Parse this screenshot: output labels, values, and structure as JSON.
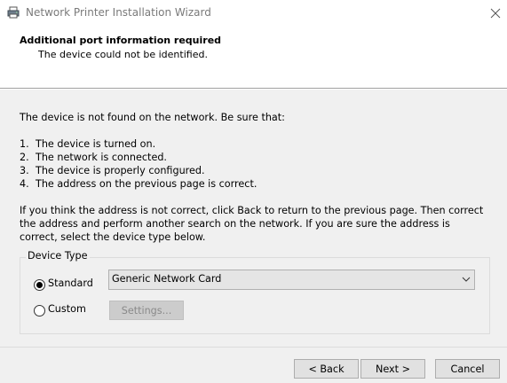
{
  "window": {
    "title": "Network Printer Installation Wizard"
  },
  "header": {
    "title": "Additional port information required",
    "subtitle": "The device could not be identified."
  },
  "body": {
    "intro": "The device is not found on the network.  Be sure that:",
    "checklist": [
      {
        "num": "1.",
        "text": "The device is turned on."
      },
      {
        "num": "2.",
        "text": "The network is connected."
      },
      {
        "num": "3.",
        "text": "The device is properly configured."
      },
      {
        "num": "4.",
        "text": "The address on the previous page is correct."
      }
    ],
    "instructions": "If you think the address is not correct, click Back to return to the previous page.  Then correct the address and perform another search on the network.  If you are sure the address is correct, select the device type below."
  },
  "device_type": {
    "group_label": "Device Type",
    "standard_label": "Standard",
    "standard_selected": true,
    "custom_label": "Custom",
    "custom_selected": false,
    "combo_value": "Generic Network Card",
    "settings_label": "Settings..."
  },
  "footer": {
    "back_label": "< Back",
    "next_label": "Next >",
    "cancel_label": "Cancel"
  },
  "icons": {
    "title_icon": "printer-icon",
    "close_icon": "close-icon",
    "dropdown_icon": "chevron-down-icon"
  },
  "colors": {
    "title_text": "#7a7a7a",
    "dialog_bg": "#f0f0f0",
    "header_bg": "#ffffff",
    "disabled_text": "#8a8a8a"
  }
}
